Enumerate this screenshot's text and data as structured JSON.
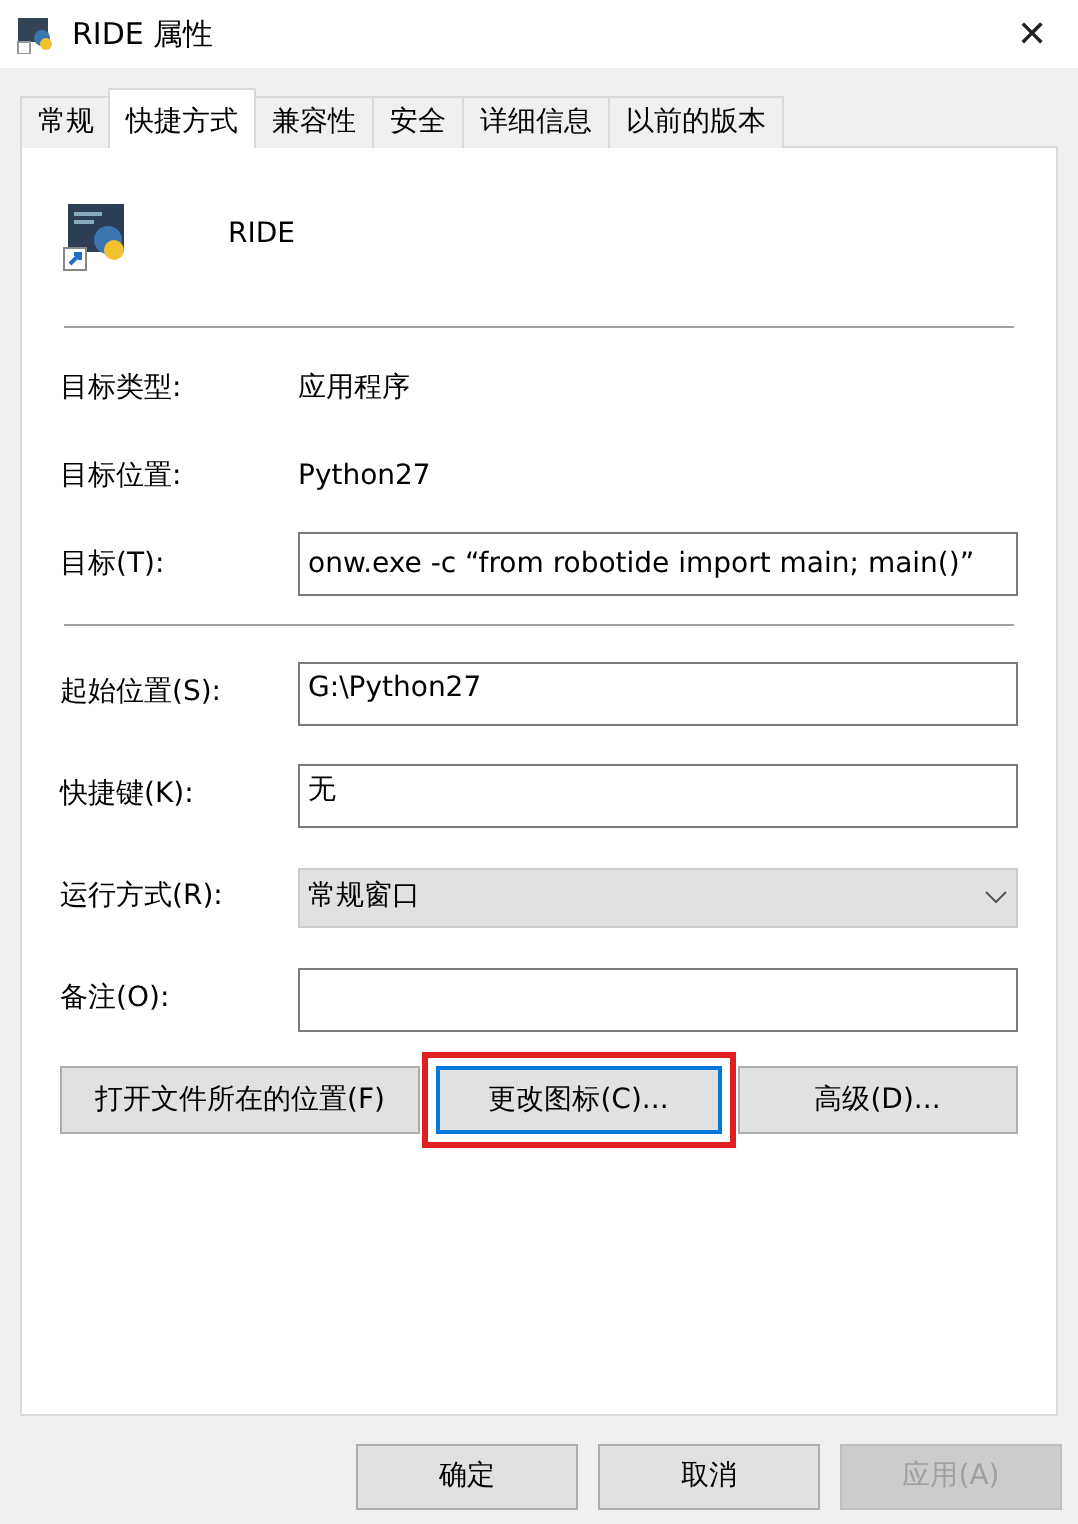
{
  "window": {
    "title": "RIDE 属性",
    "close": "✕"
  },
  "tabs": [
    {
      "label": "常规",
      "selected": false
    },
    {
      "label": "快捷方式",
      "selected": true
    },
    {
      "label": "兼容性",
      "selected": false
    },
    {
      "label": "安全",
      "selected": false
    },
    {
      "label": "详细信息",
      "selected": false
    },
    {
      "label": "以前的版本",
      "selected": false
    }
  ],
  "shortcut": {
    "name": "RIDE"
  },
  "info": [
    {
      "label": "目标类型:",
      "value": "应用程序"
    },
    {
      "label": "目标位置:",
      "value": "Python27"
    }
  ],
  "target": {
    "label": "目标(T):",
    "value": "onw.exe -c “from robotide import main; main()”"
  },
  "fields": [
    {
      "kind": "text",
      "label": "起始位置(S):",
      "value": "G:\\Python27"
    },
    {
      "kind": "text",
      "label": "快捷键(K):",
      "value": "无"
    },
    {
      "kind": "select",
      "label": "运行方式(R):",
      "value": "常规窗口"
    },
    {
      "kind": "text",
      "label": "备注(O):"
    }
  ],
  "actions": [
    {
      "label": "打开文件所在的位置(F)",
      "highlighted": false
    },
    {
      "label": "更改图标(C)...",
      "highlighted": true
    },
    {
      "label": "高级(D)...",
      "highlighted": false
    }
  ],
  "buttons": [
    {
      "label": "确定",
      "disabled": false
    },
    {
      "label": "取消",
      "disabled": false
    },
    {
      "label": "应用(A)",
      "disabled": true
    }
  ]
}
